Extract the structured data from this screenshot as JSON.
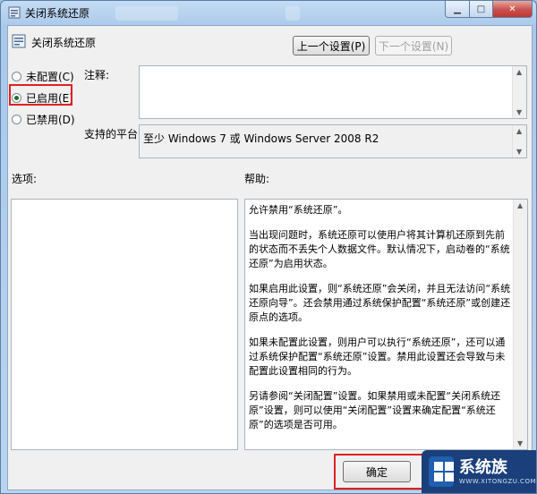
{
  "window": {
    "title": "关闭系统还原"
  },
  "header": {
    "title": "关闭系统还原"
  },
  "nav": {
    "prev_label": "上一个设置(P)",
    "next_label": "下一个设置(N)"
  },
  "radios": [
    {
      "label": "未配置(C)",
      "checked": false
    },
    {
      "label": "已启用(E)",
      "checked": true
    },
    {
      "label": "已禁用(D)",
      "checked": false
    }
  ],
  "comment": {
    "label": "注释:",
    "value": ""
  },
  "platform": {
    "label": "支持的平台:",
    "value": "至少 Windows 7 或 Windows Server 2008 R2"
  },
  "options": {
    "label": "选项:"
  },
  "help": {
    "label": "帮助:",
    "paragraphs": [
      "允许禁用“系统还原”。",
      "当出现问题时，系统还原可以使用户将其计算机还原到先前的状态而不丢失个人数据文件。默认情况下，启动卷的“系统还原”为启用状态。",
      "如果启用此设置，则“系统还原”会关闭，并且无法访问“系统还原向导”。还会禁用通过系统保护配置“系统还原”或创建还原点的选项。",
      "如果未配置此设置，则用户可以执行“系统还原”，还可以通过系统保护配置“系统还原”设置。禁用此设置还会导致与未配置此设置相同的行为。",
      "另请参阅“关闭配置”设置。如果禁用或未配置“关闭系统还原”设置，则可以使用“关闭配置”设置来确定配置“系统还原”的选项是否可用。"
    ]
  },
  "footer": {
    "ok_label": "确定"
  },
  "watermark": {
    "brand": "系统族",
    "url": "WWW.XITONGZU.COM"
  },
  "colors": {
    "highlight_red": "#e02020",
    "titlebar": "#a9c8ea",
    "close_button": "#c75050"
  }
}
